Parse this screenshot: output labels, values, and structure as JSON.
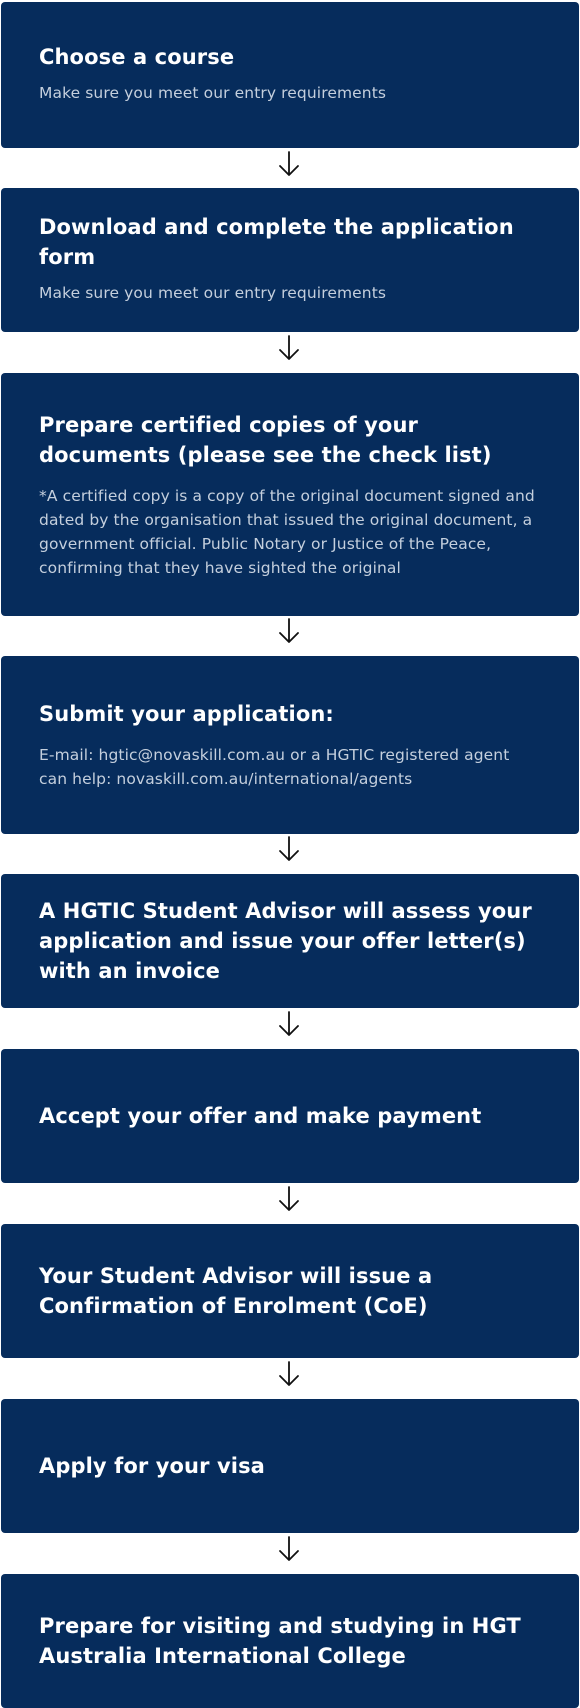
{
  "steps": [
    {
      "title": "Choose a course",
      "description": "Make sure you meet our entry requirements"
    },
    {
      "title": "Download and complete the application form",
      "description": "Make sure you meet our entry requirements"
    },
    {
      "title": "Prepare certified copies of your documents (please see the check list)",
      "description": "*A certified copy is a copy of the original document signed and dated by the organisation that issued the original document, a government official. Public Notary or Justice of the Peace, confirming that they have sighted the original"
    },
    {
      "title": "Submit your application:",
      "description": "E-mail: hgtic@novaskill.com.au or a HGTIC registered agent can help: novaskill.com.au/international/agents"
    },
    {
      "title": "A HGTIC Student Advisor will assess your application and issue your offer letter(s) with an invoice"
    },
    {
      "title": "Accept your offer and make payment"
    },
    {
      "title": "Your Student Advisor will issue a Confirmation of Enrolment (CoE)"
    },
    {
      "title": "Apply for your visa"
    },
    {
      "title": "Prepare for visiting and studying in HGT Australia International College"
    }
  ],
  "colors": {
    "step_background": "#062c5c",
    "title_text": "#ffffff",
    "description_text": "#c4cfdd",
    "arrow": "#111111"
  },
  "icons": {
    "connector": "arrow-down-icon"
  }
}
